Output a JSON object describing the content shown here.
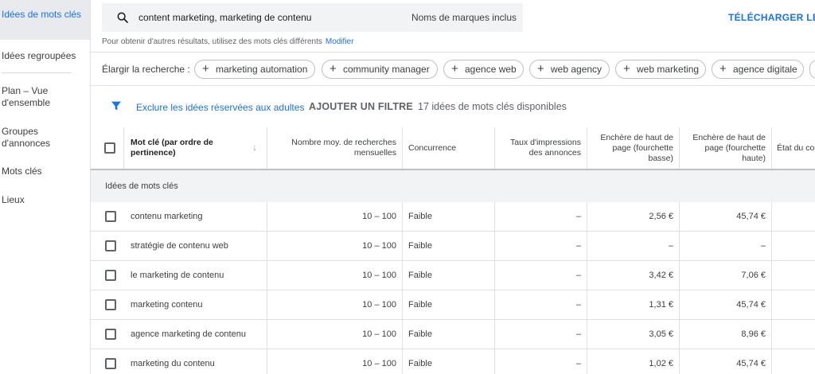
{
  "sidebar": {
    "items": [
      {
        "label": "Idées de mots clés"
      },
      {
        "label": "Idées regroupées"
      },
      {
        "label": "Plan – Vue d'ensemble"
      },
      {
        "label": "Groupes d'annonces"
      },
      {
        "label": "Mots clés"
      },
      {
        "label": "Lieux"
      }
    ]
  },
  "search": {
    "query": "content marketing, marketing de contenu",
    "brand_option": "Noms de marques inclus",
    "download_label": "TÉLÉCHARGER LES",
    "hint": "Pour obtenir d'autres résultats, utilisez des mots clés différents",
    "hint_link": "Modifier"
  },
  "expand": {
    "label": "Élargir la recherche :",
    "chips": [
      "marketing automation",
      "community manager",
      "agence web",
      "web agency",
      "web marketing",
      "agence digitale"
    ]
  },
  "filters": {
    "adult_filter": "Exclure les idées réservées aux adultes",
    "add_filter": "AJOUTER UN FILTRE",
    "count_text": "17 idées de mots clés disponibles"
  },
  "table": {
    "headers": {
      "keyword": "Mot clé (par ordre de pertinence)",
      "searches": "Nombre moy. de recherches mensuelles",
      "competition": "Concurrence",
      "impressions": "Taux d'impressions des annonces",
      "bid_low": "Enchère de haut de page (fourchette basse)",
      "bid_high": "Enchère de haut de page (fourchette haute)",
      "status": "État du co"
    },
    "group_label": "Idées de mots clés",
    "rows": [
      {
        "keyword": "contenu marketing",
        "searches": "10 – 100",
        "competition": "Faible",
        "impressions": "–",
        "bid_low": "2,56 €",
        "bid_high": "45,74 €"
      },
      {
        "keyword": "stratégie de contenu web",
        "searches": "10 – 100",
        "competition": "Faible",
        "impressions": "–",
        "bid_low": "–",
        "bid_high": "–"
      },
      {
        "keyword": "le marketing de contenu",
        "searches": "10 – 100",
        "competition": "Faible",
        "impressions": "–",
        "bid_low": "3,42 €",
        "bid_high": "7,06 €"
      },
      {
        "keyword": "marketing contenu",
        "searches": "10 – 100",
        "competition": "Faible",
        "impressions": "–",
        "bid_low": "1,31 €",
        "bid_high": "45,74 €"
      },
      {
        "keyword": "agence marketing de contenu",
        "searches": "10 – 100",
        "competition": "Faible",
        "impressions": "–",
        "bid_low": "3,05 €",
        "bid_high": "8,96 €"
      },
      {
        "keyword": "marketing du contenu",
        "searches": "10 – 100",
        "competition": "Faible",
        "impressions": "–",
        "bid_low": "1,02 €",
        "bid_high": "45,74 €"
      }
    ]
  }
}
